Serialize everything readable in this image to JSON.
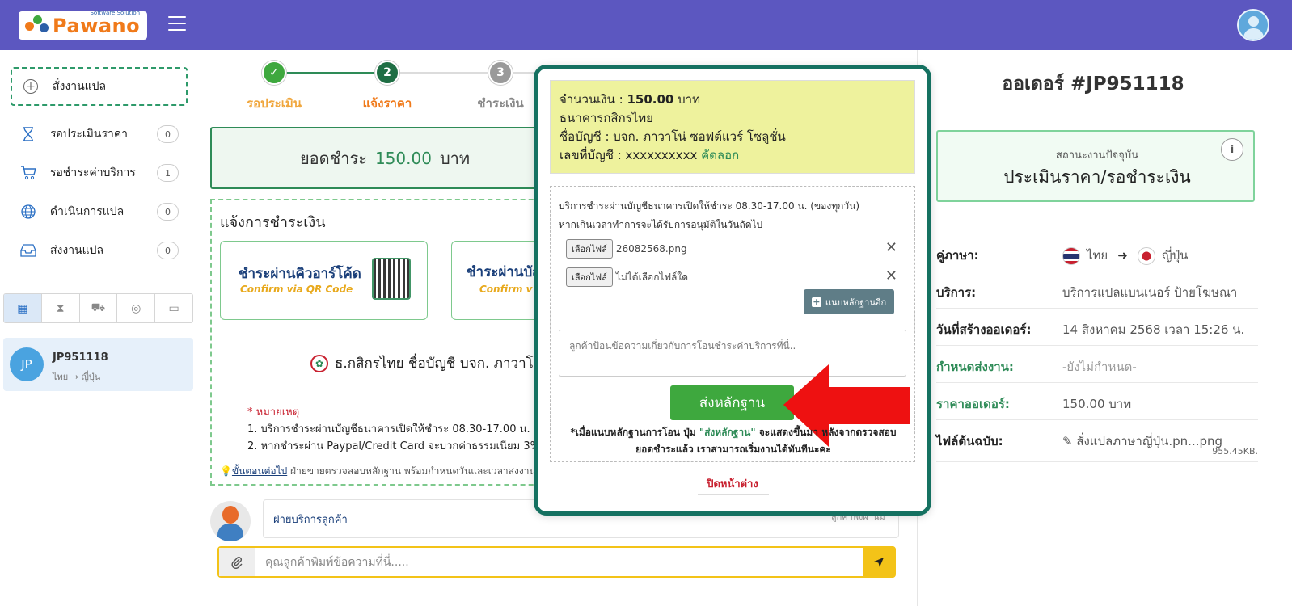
{
  "header": {
    "logo_text": "Pawano",
    "logo_tagline": "Software Solution",
    "menu_icon": "hamburger-icon",
    "avatar_icon": "user-avatar-icon"
  },
  "sidebar": {
    "new_job_label": "สั่งงานแปล",
    "items": [
      {
        "label": "รอประเมินราคา",
        "count": "0",
        "icon": "hourglass-icon"
      },
      {
        "label": "รอชำระค่าบริการ",
        "count": "1",
        "icon": "cart-icon"
      },
      {
        "label": "ดำเนินการแปล",
        "count": "0",
        "icon": "globe-icon"
      },
      {
        "label": "ส่งงานแปล",
        "count": "0",
        "icon": "inbox-icon"
      }
    ],
    "job": {
      "avatar": "JP",
      "id": "JP951118",
      "langs": "ไทย → ญี่ปุ่น"
    }
  },
  "steps": [
    {
      "label": "รอประเมิน",
      "mark": "✓"
    },
    {
      "label": "แจ้งราคา",
      "mark": "2"
    },
    {
      "label": "ชำระเงิน",
      "mark": "3"
    }
  ],
  "main": {
    "total_prefix": "ยอดชำระ",
    "total_amount": "150.00",
    "total_unit": "บาท",
    "pay_title": "แจ้งการชำระเงิน",
    "qr_title": "ชำระผ่านคิวอาร์โค้ด",
    "qr_sub": "Confirm via QR Code",
    "bank_title": "ชำระผ่านบัญ",
    "bank_sub": "Confirm v",
    "kbank_line": "ธ.กสิกรไทย ชื่อบัญชี บจก. ภาวาโน่",
    "note_head": "* หมายเหตุ",
    "note_1": "1. บริการชำระผ่านบัญชีธนาคารเปิดให้ชำระ 08.30-17.00 น. (ของ",
    "note_2": "2. หากชำระผ่าน Paypal/Credit Card จะบวกค่าธรรมเนียม 3%",
    "next_link": "ขั้นตอนต่อไป",
    "next_text": " ฝ่ายขายตรวจสอบหลักฐาน พร้อมกำหนดวันและเวลาส่งงาน",
    "cs_name": "ฝ่ายบริการลูกค้า",
    "cs_time": "ลูกค้าพึ่งผ่านมา",
    "msg_placeholder": "คุณลูกค้าพิมพ์ข้อความที่นี่....."
  },
  "order": {
    "title": "ออเดอร์ #JP951118",
    "status_label": "สถานะงานปัจจุบัน",
    "status_value": "ประเมินราคา/รอชำระเงิน",
    "rows": [
      {
        "k": "คู่ภาษา:",
        "from": "ไทย",
        "to": "ญี่ปุ่น"
      },
      {
        "k": "บริการ:",
        "v": "บริการแปลแบนเนอร์ ป้ายโฆษณา"
      },
      {
        "k": "วันที่สร้างออเดอร์:",
        "v": "14 สิงหาคม 2568 เวลา 15:26 น."
      },
      {
        "k": "กำหนดส่งงาน:",
        "v": "-ยังไม่กำหนด-"
      },
      {
        "k": "ราคาออเดอร์:",
        "v": "150.00 บาท"
      },
      {
        "k": "ไฟล์ต้นฉบับ:",
        "v": "สั่งแปลภาษาญี่ปุ่น.pn...png",
        "size": "955.45KB."
      }
    ]
  },
  "modal": {
    "amount_label": "จำนวนเงิน :",
    "amount": "150.00",
    "amount_unit": "บาท",
    "bank": "ธนาคารกสิกรไทย",
    "acc_name": "ชื่อบัญชี : บจก. ภาวาโน่ ซอฟต์แวร์ โซลูชั่น",
    "acc_no_label": "เลขที่บัญชี : ",
    "acc_no": "xxxxxxxxxx",
    "copy": "คัดลอก",
    "hours_1": "บริการชำระผ่านบัญชีธนาคารเปิดให้ชำระ 08.30-17.00 น. (ของทุกวัน)",
    "hours_2": "หากเกินเวลาทำการจะได้รับการอนุมัติในวันถัดไป",
    "file_btn": "เลือกไฟล์",
    "file_1": "26082568.png",
    "file_2": "ไม่ได้เลือกไฟล์ใด",
    "add_proof": "แนบหลักฐานอีก",
    "textarea_placeholder": "ลูกค้าป้อนข้อความเกี่ยวกับการโอนชำระค่าบริการที่นี่..",
    "send_proof": "ส่งหลักฐาน",
    "foot_1a": "*เมื่อแนบหลักฐานการโอน ปุ่ม ",
    "foot_1b": "\"ส่งหลักฐาน\"",
    "foot_1c": " จะแสดงขึ้นมา หลังจากตรวจสอบ",
    "foot_2": "ยอดชำระแล้ว เราสามารถเริ่มงานได้ทันทีนะคะ",
    "close": "ปิดหน้าต่าง"
  },
  "colors": {
    "header": "#5c57c0",
    "green": "#2e8b57",
    "accent_red": "#c8202f",
    "modal_border": "#157161"
  }
}
